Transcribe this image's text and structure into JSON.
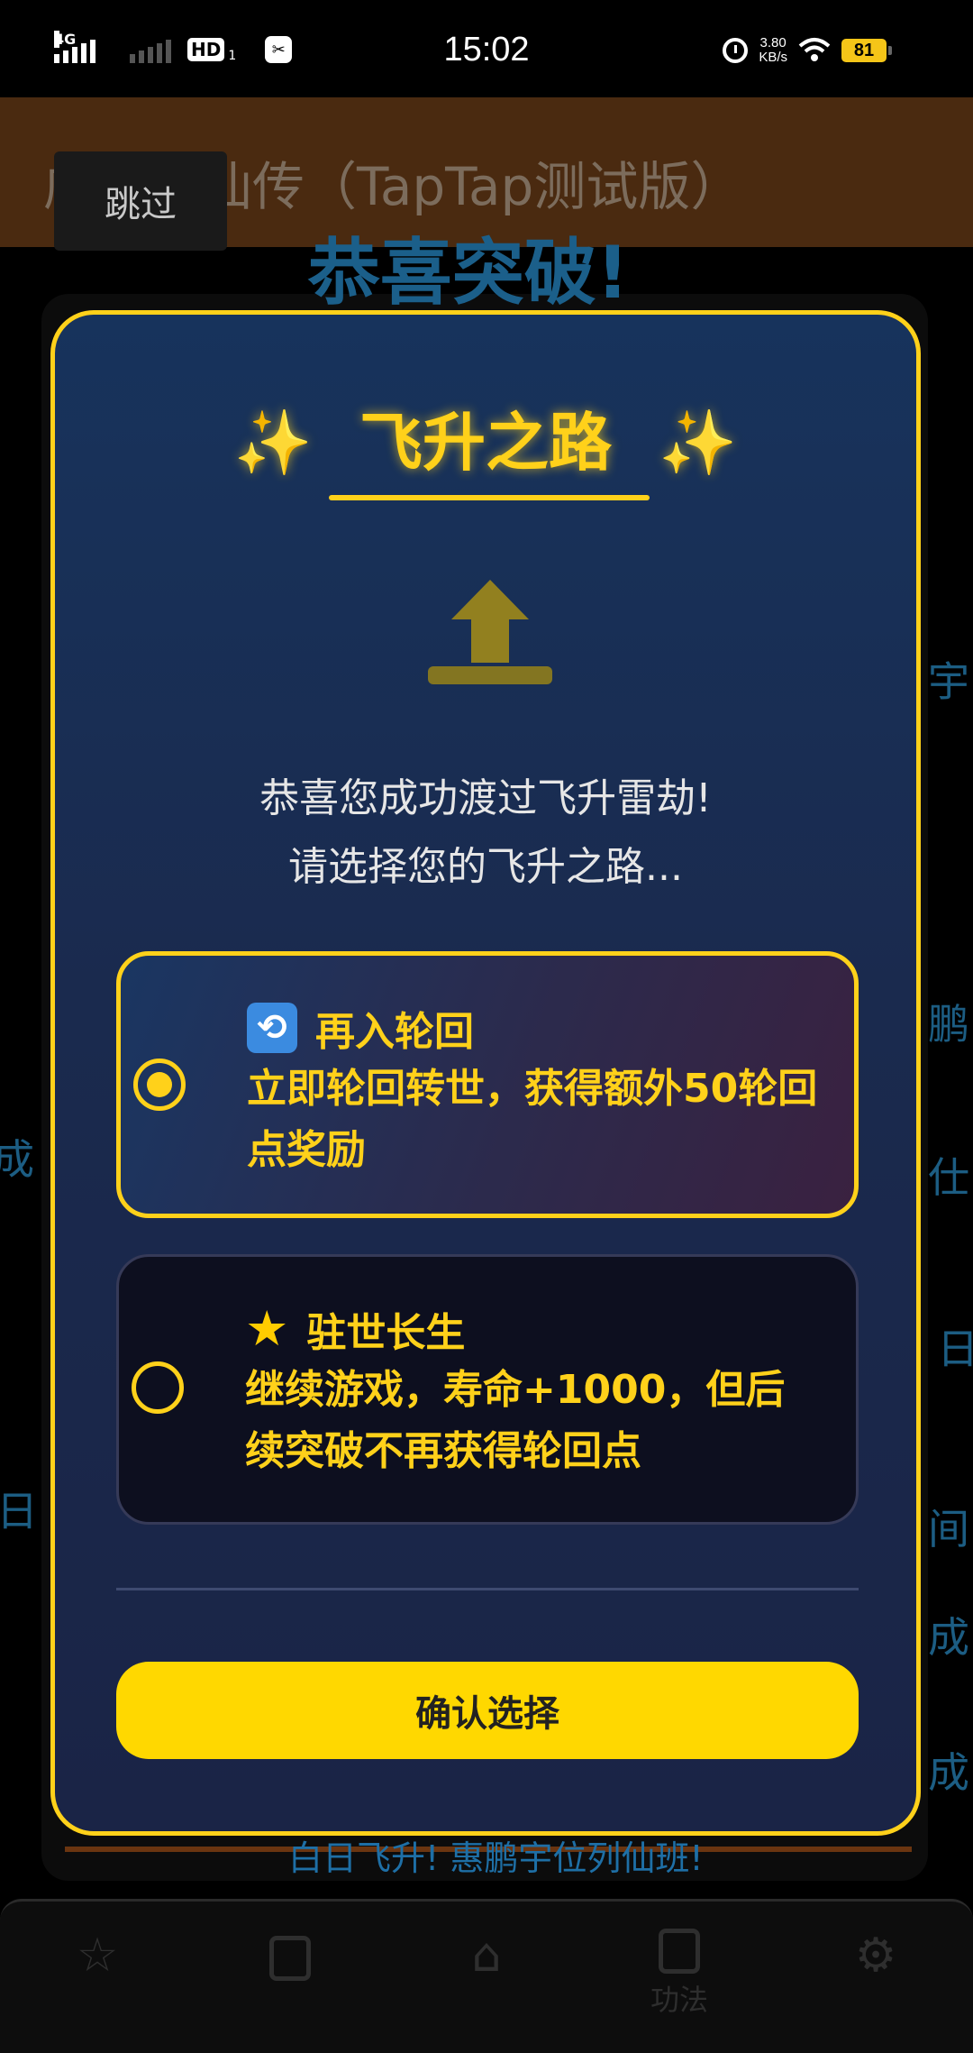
{
  "status_bar": {
    "network": "4G",
    "hd": "HD",
    "hd_sub": "1",
    "time": "15:02",
    "speed_value": "3.80",
    "speed_unit": "KB/s",
    "battery": "81"
  },
  "background": {
    "title": "咸鱼修仙传（TapTap测试版）",
    "skip": "跳过",
    "congrats": "恭喜突破!",
    "floats": [
      "宇",
      "成",
      "日",
      "间",
      "鹏",
      "成",
      "仕",
      "日",
      "成"
    ],
    "bottom_text": "白日飞升! 惠鹏宇位列仙班!",
    "nav": {
      "items": [
        "",
        "",
        "",
        "功法",
        ""
      ]
    }
  },
  "modal": {
    "spark_left": "✨",
    "title": "飞升之路",
    "spark_right": "✨",
    "message_line1": "恭喜您成功渡过飞升雷劫!",
    "message_line2": "请选择您的飞升之路...",
    "options": [
      {
        "icon": "cycle-icon",
        "icon_glyph": "🔄",
        "title": "再入轮回",
        "description": "立即轮回转世，获得额外50轮回点奖励",
        "selected": true
      },
      {
        "icon": "star-icon",
        "icon_glyph": "★",
        "title": "驻世长生",
        "description": "继续游戏，寿命+1000，但后续突破不再获得轮回点",
        "selected": false
      }
    ],
    "confirm": "确认选择"
  },
  "colors": {
    "accent": "#ffd11a",
    "modal_bg": "#17335c",
    "background_text": "#1c5d83"
  }
}
